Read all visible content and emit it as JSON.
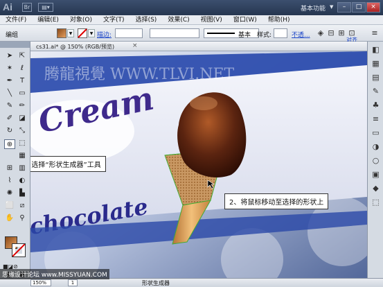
{
  "titlebar": {
    "app_logo": "Ai",
    "workspace": "基本功能",
    "window_buttons": [
      "–",
      "□",
      "×"
    ]
  },
  "menu": [
    "文件(F)",
    "编辑(E)",
    "对象(O)",
    "文字(T)",
    "选择(S)",
    "效果(C)",
    "视图(V)",
    "窗口(W)",
    "帮助(H)"
  ],
  "control": {
    "group_label": "编组",
    "stroke_link": "描边:",
    "stroke_style": "基本",
    "style_label": "样式:",
    "opacity_link": "不透...",
    "align_link": "对齐"
  },
  "document": {
    "tab_label": "cs31.ai* @ 150% (RGB/预览)",
    "close_icon": "×",
    "art": {
      "brand_text": "Cream",
      "product_text": "chocolate",
      "site_watermark": "腾龍視覺 WWW.TLVI.NET"
    }
  },
  "callouts": {
    "step1": "1、选择“形状生成器”工具",
    "step2": "2、将鼠标移动至选择的形状上"
  },
  "status": {
    "zoom": "150%",
    "page": "1",
    "tool_name": "形状生成器"
  },
  "footer_watermark": "思缘设计论坛 www.MISSYUAN.COM",
  "colors": {
    "title_bg": "#263650",
    "panel_bg": "#d5dbe3",
    "link": "#1a44c8"
  }
}
